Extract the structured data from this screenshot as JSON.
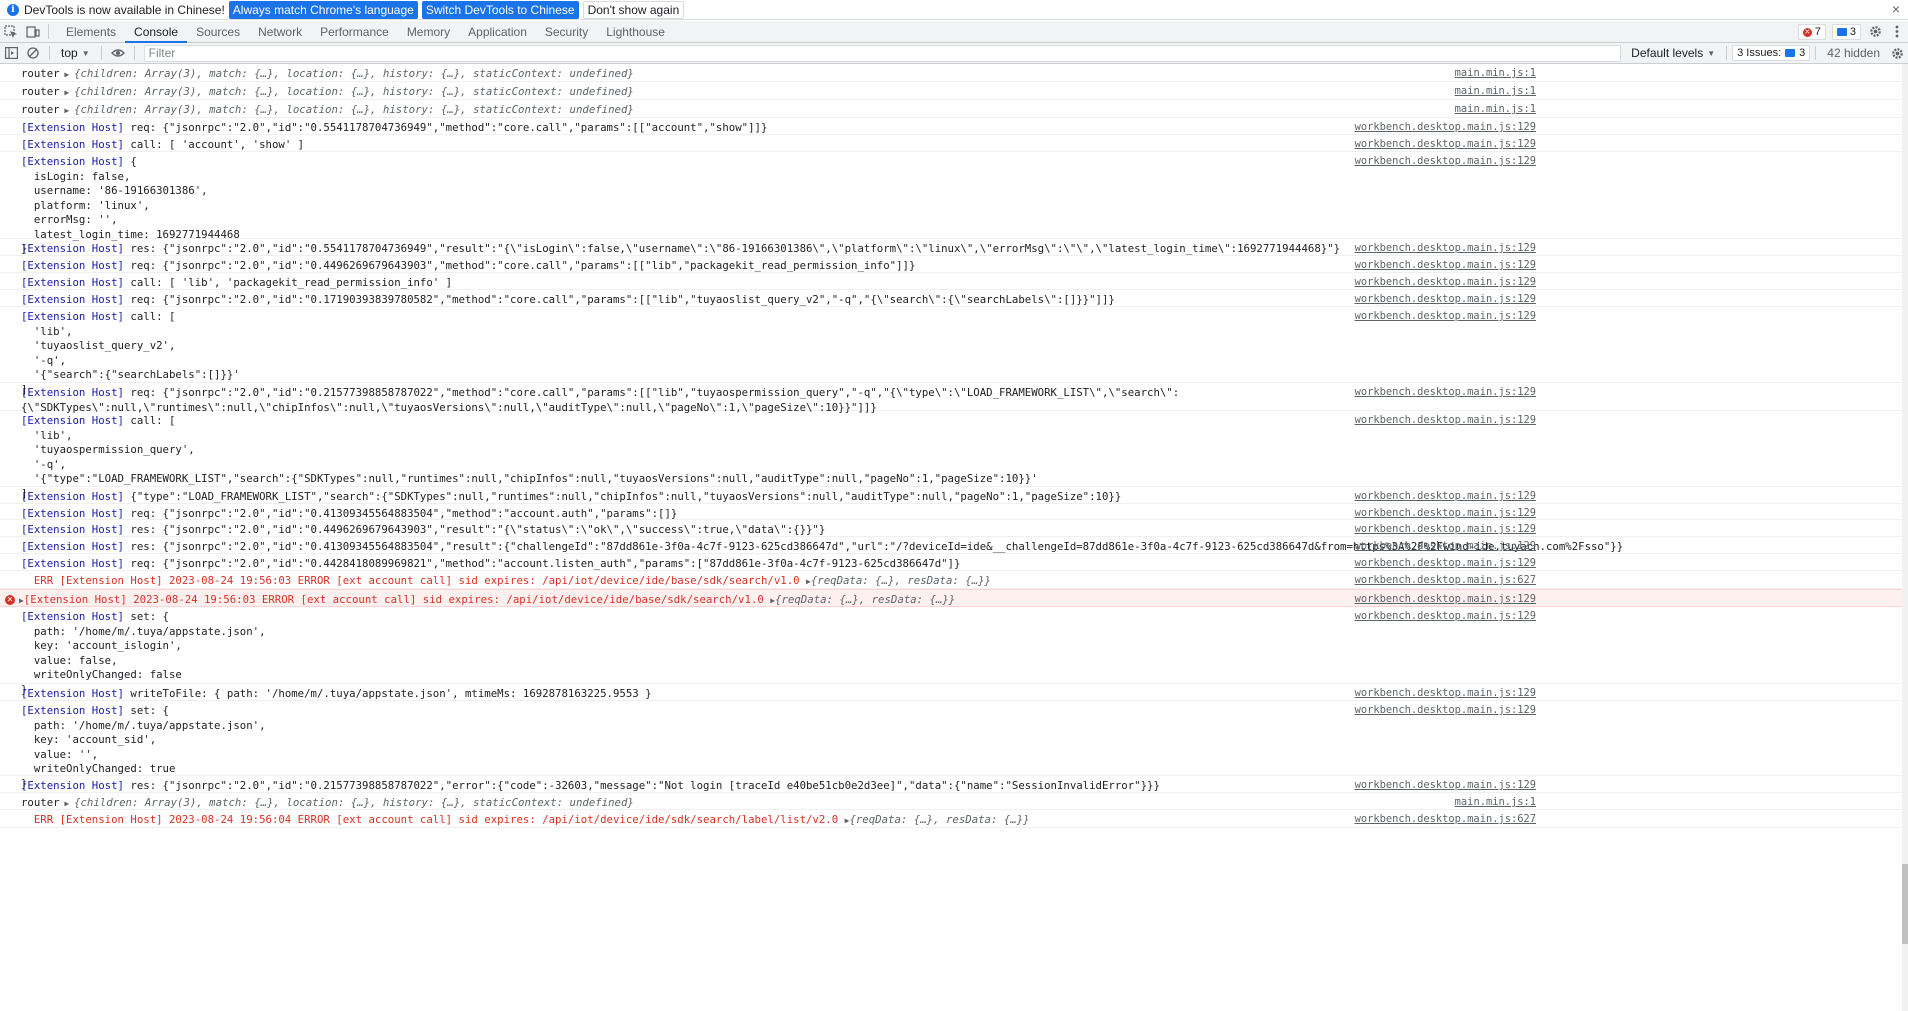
{
  "infobar": {
    "text": "DevTools is now available in Chinese!",
    "btn_match": "Always match Chrome's language",
    "btn_switch": "Switch DevTools to Chinese",
    "btn_dont": "Don't show again",
    "close": "×"
  },
  "tabs": [
    "Elements",
    "Console",
    "Sources",
    "Network",
    "Performance",
    "Memory",
    "Application",
    "Security",
    "Lighthouse"
  ],
  "active_tab": "Console",
  "counts": {
    "errors": "7",
    "messages": "3"
  },
  "toolbar": {
    "context": "top",
    "filter_placeholder": "Filter",
    "levels": "Default levels",
    "issues_label": "3 Issues:",
    "issues_count": "3",
    "hidden": "42 hidden"
  },
  "colors": {
    "accent": "#1a73e8",
    "error": "#d93025",
    "ext_host": "#1a1aa6"
  },
  "console": [
    {
      "type": "router",
      "label": "router",
      "obj": "{children: Array(3), match: {…}, location: {…}, history: {…}, staticContext: undefined}",
      "src": "main.min.js:1"
    },
    {
      "type": "router",
      "label": "router",
      "obj": "{children: Array(3), match: {…}, location: {…}, history: {…}, staticContext: undefined}",
      "src": "main.min.js:1"
    },
    {
      "type": "router",
      "label": "router",
      "obj": "{children: Array(3), match: {…}, location: {…}, history: {…}, staticContext: undefined}",
      "src": "main.min.js:1"
    },
    {
      "type": "ext",
      "prefix": "[Extension Host]",
      "text": " req: {\"jsonrpc\":\"2.0\",\"id\":\"0.5541178704736949\",\"method\":\"core.call\",\"params\":[[\"account\",\"show\"]]}",
      "src": "workbench.desktop.main.js:129"
    },
    {
      "type": "ext",
      "prefix": "[Extension Host]",
      "text": " call: [ 'account', 'show' ]",
      "src": "workbench.desktop.main.js:129"
    },
    {
      "type": "ext",
      "prefix": "[Extension Host]",
      "text": " {\n  isLogin: false,\n  username: '86-19166301386',\n  platform: 'linux',\n  errorMsg: '',\n  latest_login_time: 1692771944468\n}",
      "src": "workbench.desktop.main.js:129"
    },
    {
      "type": "ext",
      "prefix": "[Extension Host]",
      "text": " res: {\"jsonrpc\":\"2.0\",\"id\":\"0.5541178704736949\",\"result\":\"{\\\"isLogin\\\":false,\\\"username\\\":\\\"86-19166301386\\\",\\\"platform\\\":\\\"linux\\\",\\\"errorMsg\\\":\\\"\\\",\\\"latest_login_time\\\":1692771944468}\"}",
      "src": "workbench.desktop.main.js:129"
    },
    {
      "type": "ext",
      "prefix": "[Extension Host]",
      "text": " req: {\"jsonrpc\":\"2.0\",\"id\":\"0.4496269679643903\",\"method\":\"core.call\",\"params\":[[\"lib\",\"packagekit_read_permission_info\"]]}",
      "src": "workbench.desktop.main.js:129"
    },
    {
      "type": "ext",
      "prefix": "[Extension Host]",
      "text": " call: [ 'lib', 'packagekit_read_permission_info' ]",
      "src": "workbench.desktop.main.js:129"
    },
    {
      "type": "ext",
      "prefix": "[Extension Host]",
      "text": " req: {\"jsonrpc\":\"2.0\",\"id\":\"0.17190393839780582\",\"method\":\"core.call\",\"params\":[[\"lib\",\"tuyaoslist_query_v2\",\"-q\",\"{\\\"search\\\":{\\\"searchLabels\\\":[]}}\"]]}",
      "src": "workbench.desktop.main.js:129"
    },
    {
      "type": "ext",
      "prefix": "[Extension Host]",
      "text": " call: [\n  'lib',\n  'tuyaoslist_query_v2',\n  '-q',\n  '{\"search\":{\"searchLabels\":[]}}'\n]",
      "src": "workbench.desktop.main.js:129"
    },
    {
      "type": "ext",
      "prefix": "[Extension Host]",
      "text": " req: {\"jsonrpc\":\"2.0\",\"id\":\"0.21577398858787022\",\"method\":\"core.call\",\"params\":[[\"lib\",\"tuyaospermission_query\",\"-q\",\"{\\\"type\\\":\\\"LOAD_FRAMEWORK_LIST\\\",\\\"search\\\":\n{\\\"SDKTypes\\\":null,\\\"runtimes\\\":null,\\\"chipInfos\\\":null,\\\"tuyaosVersions\\\":null,\\\"auditType\\\":null,\\\"pageNo\\\":1,\\\"pageSize\\\":10}}\"]]}",
      "src": "workbench.desktop.main.js:129"
    },
    {
      "type": "ext",
      "prefix": "[Extension Host]",
      "text": " call: [\n  'lib',\n  'tuyaospermission_query',\n  '-q',\n  '{\"type\":\"LOAD_FRAMEWORK_LIST\",\"search\":{\"SDKTypes\":null,\"runtimes\":null,\"chipInfos\":null,\"tuyaosVersions\":null,\"auditType\":null,\"pageNo\":1,\"pageSize\":10}}'\n]",
      "src": "workbench.desktop.main.js:129"
    },
    {
      "type": "ext",
      "prefix": "[Extension Host]",
      "text": " {\"type\":\"LOAD_FRAMEWORK_LIST\",\"search\":{\"SDKTypes\":null,\"runtimes\":null,\"chipInfos\":null,\"tuyaosVersions\":null,\"auditType\":null,\"pageNo\":1,\"pageSize\":10}}",
      "src": "workbench.desktop.main.js:129"
    },
    {
      "type": "ext",
      "prefix": "[Extension Host]",
      "text": " req: {\"jsonrpc\":\"2.0\",\"id\":\"0.41309345564883504\",\"method\":\"account.auth\",\"params\":[]}",
      "src": "workbench.desktop.main.js:129"
    },
    {
      "type": "ext",
      "prefix": "[Extension Host]",
      "text": " res: {\"jsonrpc\":\"2.0\",\"id\":\"0.4496269679643903\",\"result\":\"{\\\"status\\\":\\\"ok\\\",\\\"success\\\":true,\\\"data\\\":{}}\"}",
      "src": "workbench.desktop.main.js:129"
    },
    {
      "type": "ext",
      "prefix": "[Extension Host]",
      "text": " res: {\"jsonrpc\":\"2.0\",\"id\":\"0.41309345564883504\",\"result\":{\"challengeId\":\"87dd861e-3f0a-4c7f-9123-625cd386647d\",\"url\":\"/?deviceId=ide&__challengeId=87dd861e-3f0a-4c7f-9123-625cd386647d&from=https%3A%2F%2Fwind-ide.tuyacn.com%2Fsso\"}}",
      "src": "workbench.desktop.main.js:129"
    },
    {
      "type": "ext",
      "prefix": "[Extension Host]",
      "text": " req: {\"jsonrpc\":\"2.0\",\"id\":\"0.4428418089969821\",\"method\":\"account.listen_auth\",\"params\":[\"87dd861e-3f0a-4c7f-9123-625cd386647d\"]}",
      "src": "workbench.desktop.main.js:129"
    },
    {
      "type": "errlog",
      "text": "  ERR [Extension Host] 2023-08-24 19:56:03 ERROR [ext account call] sid expires: /api/iot/device/ide/base/sdk/search/v1.0 ",
      "obj": "{reqData: {…}, resData: {…}}",
      "src": "workbench.desktop.main.js:627"
    },
    {
      "type": "error",
      "text": "[Extension Host] 2023-08-24 19:56:03 ERROR [ext account call] sid expires: /api/iot/device/ide/base/sdk/search/v1.0 ",
      "obj": "{reqData: {…}, resData: {…}}",
      "src": "workbench.desktop.main.js:129"
    },
    {
      "type": "ext",
      "prefix": "[Extension Host]",
      "text": " set: {\n  path: '/home/m/.tuya/appstate.json',\n  key: 'account_islogin',\n  value: false,\n  writeOnlyChanged: false\n}",
      "src": "workbench.desktop.main.js:129"
    },
    {
      "type": "ext",
      "prefix": "[Extension Host]",
      "text": " writeToFile: { path: '/home/m/.tuya/appstate.json', mtimeMs: 1692878163225.9553 }",
      "src": "workbench.desktop.main.js:129"
    },
    {
      "type": "ext",
      "prefix": "[Extension Host]",
      "text": " set: {\n  path: '/home/m/.tuya/appstate.json',\n  key: 'account_sid',\n  value: '',\n  writeOnlyChanged: true\n}",
      "src": "workbench.desktop.main.js:129"
    },
    {
      "type": "ext",
      "prefix": "[Extension Host]",
      "text": " res: {\"jsonrpc\":\"2.0\",\"id\":\"0.21577398858787022\",\"error\":{\"code\":-32603,\"message\":\"Not login [traceId e40be51cb0e2d3ee]\",\"data\":{\"name\":\"SessionInvalidError\"}}}",
      "src": "workbench.desktop.main.js:129"
    },
    {
      "type": "router",
      "label": "router",
      "obj": "{children: Array(3), match: {…}, location: {…}, history: {…}, staticContext: undefined}",
      "src": "main.min.js:1"
    },
    {
      "type": "errlog",
      "text": "  ERR [Extension Host] 2023-08-24 19:56:04 ERROR [ext account call] sid expires: /api/iot/device/ide/sdk/search/label/list/v2.0 ",
      "obj": "{reqData: {…}, resData: {…}}",
      "src": "workbench.desktop.main.js:627"
    }
  ]
}
